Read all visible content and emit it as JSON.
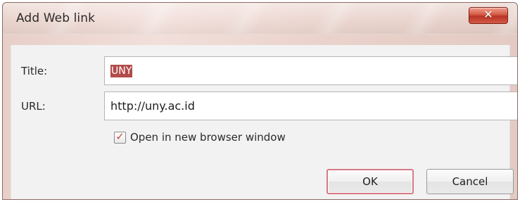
{
  "dialog": {
    "title": "Add Web link",
    "close_icon": "close-icon",
    "accent": "#c84b3b"
  },
  "form": {
    "title_label": "Title:",
    "title_value_selected": "UNY",
    "url_label": "URL:",
    "url_value": "http://uny.ac.id",
    "open_new_window_checked": true,
    "open_new_window_label": "Open in new browser window"
  },
  "buttons": {
    "ok_label": "OK",
    "cancel_label": "Cancel"
  }
}
